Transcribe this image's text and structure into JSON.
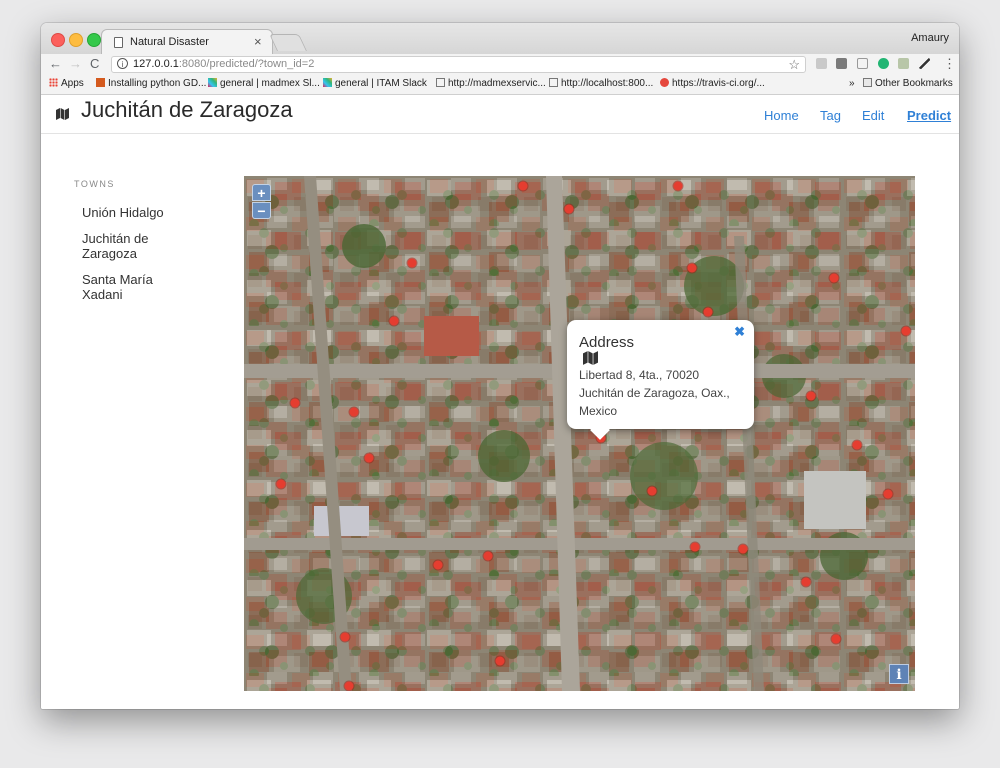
{
  "browser": {
    "tab_title": "Natural Disaster",
    "tab_close": "×",
    "user_name": "Amaury",
    "url_host": "127.0.0.1",
    "url_path": ":8080/predicted/?town_id=2",
    "bookmarks": [
      "Apps",
      "Installing python GD...",
      "general | madmex Sl...",
      "general | ITAM Slack",
      "http://madmexservic...",
      "http://localhost:800...",
      "https://travis-ci.org/...",
      "Other Bookmarks"
    ],
    "bookmarks_overflow": "»"
  },
  "header": {
    "title": "Juchitán de Zaragoza",
    "nav": [
      "Home",
      "Tag",
      "Edit",
      "Predict"
    ],
    "active_nav": "Predict"
  },
  "sidebar": {
    "heading": "TOWNS",
    "towns": [
      "Unión Hidalgo",
      "Juchitán de Zaragoza",
      "Santa María Xadani"
    ]
  },
  "map": {
    "zoom_in": "+",
    "zoom_out": "−",
    "attribution": "i",
    "marker_color": "#e53d30",
    "popup": {
      "title": "Address",
      "close": "✖",
      "address_lines": [
        "Libertad 8, 4ta., 70020",
        "Juchitán de Zaragoza, Oax.,",
        "Mexico"
      ]
    }
  },
  "colors": {
    "link": "#2f80d6",
    "zoom_control": "#6a8fbf"
  }
}
